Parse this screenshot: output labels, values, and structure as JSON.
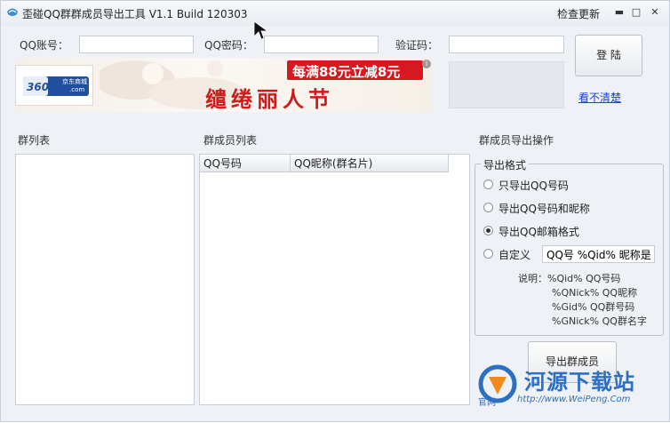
{
  "window": {
    "title": "歪碰QQ群群成员导出工具 V1.1 Build 120303",
    "update_link": "检查更新",
    "controls": [
      "minimize-icon",
      "maximize-icon",
      "close-icon"
    ]
  },
  "login": {
    "account_label": "QQ账号：",
    "account_value": "",
    "password_label": "QQ密码：",
    "password_value": "",
    "captcha_label": "验证码：",
    "captcha_value": "",
    "login_button": "登  陆",
    "captcha_refresh_link": "看不清楚"
  },
  "banner": {
    "brand": "360buy",
    "brand_sub": "京东商城",
    "brand_domain": ".com",
    "promo": "每满88元立减8元",
    "festival": "缱绻丽人节",
    "info_icon": "info-icon"
  },
  "groups": {
    "label": "群列表",
    "items": []
  },
  "members": {
    "label": "群成员列表",
    "columns": [
      "QQ号码",
      "QQ昵称(群名片)"
    ],
    "rows": []
  },
  "export": {
    "section_label": "群成员导出操作",
    "group_title": "导出格式",
    "options": [
      {
        "label": "只导出QQ号码",
        "selected": false
      },
      {
        "label": "导出QQ号码和昵称",
        "selected": false
      },
      {
        "label": "导出QQ邮箱格式",
        "selected": true
      },
      {
        "label": "自定义",
        "selected": false
      }
    ],
    "custom_value": "QQ号 %Qid% 昵称是 %",
    "notes": [
      "说明：%Qid%  QQ号码",
      "%QNick%  QQ昵称",
      "%Gid%  QQ群号码",
      "%GNick%  QQ群名字"
    ],
    "export_button": "导出群成员"
  },
  "watermark": {
    "name": "河源下载站",
    "prefix": "官网",
    "url": "http://www.WeiPeng.Com"
  },
  "colors": {
    "link": "#1c43d6",
    "background": "#eef1f5",
    "banner_accent": "#d61920"
  }
}
